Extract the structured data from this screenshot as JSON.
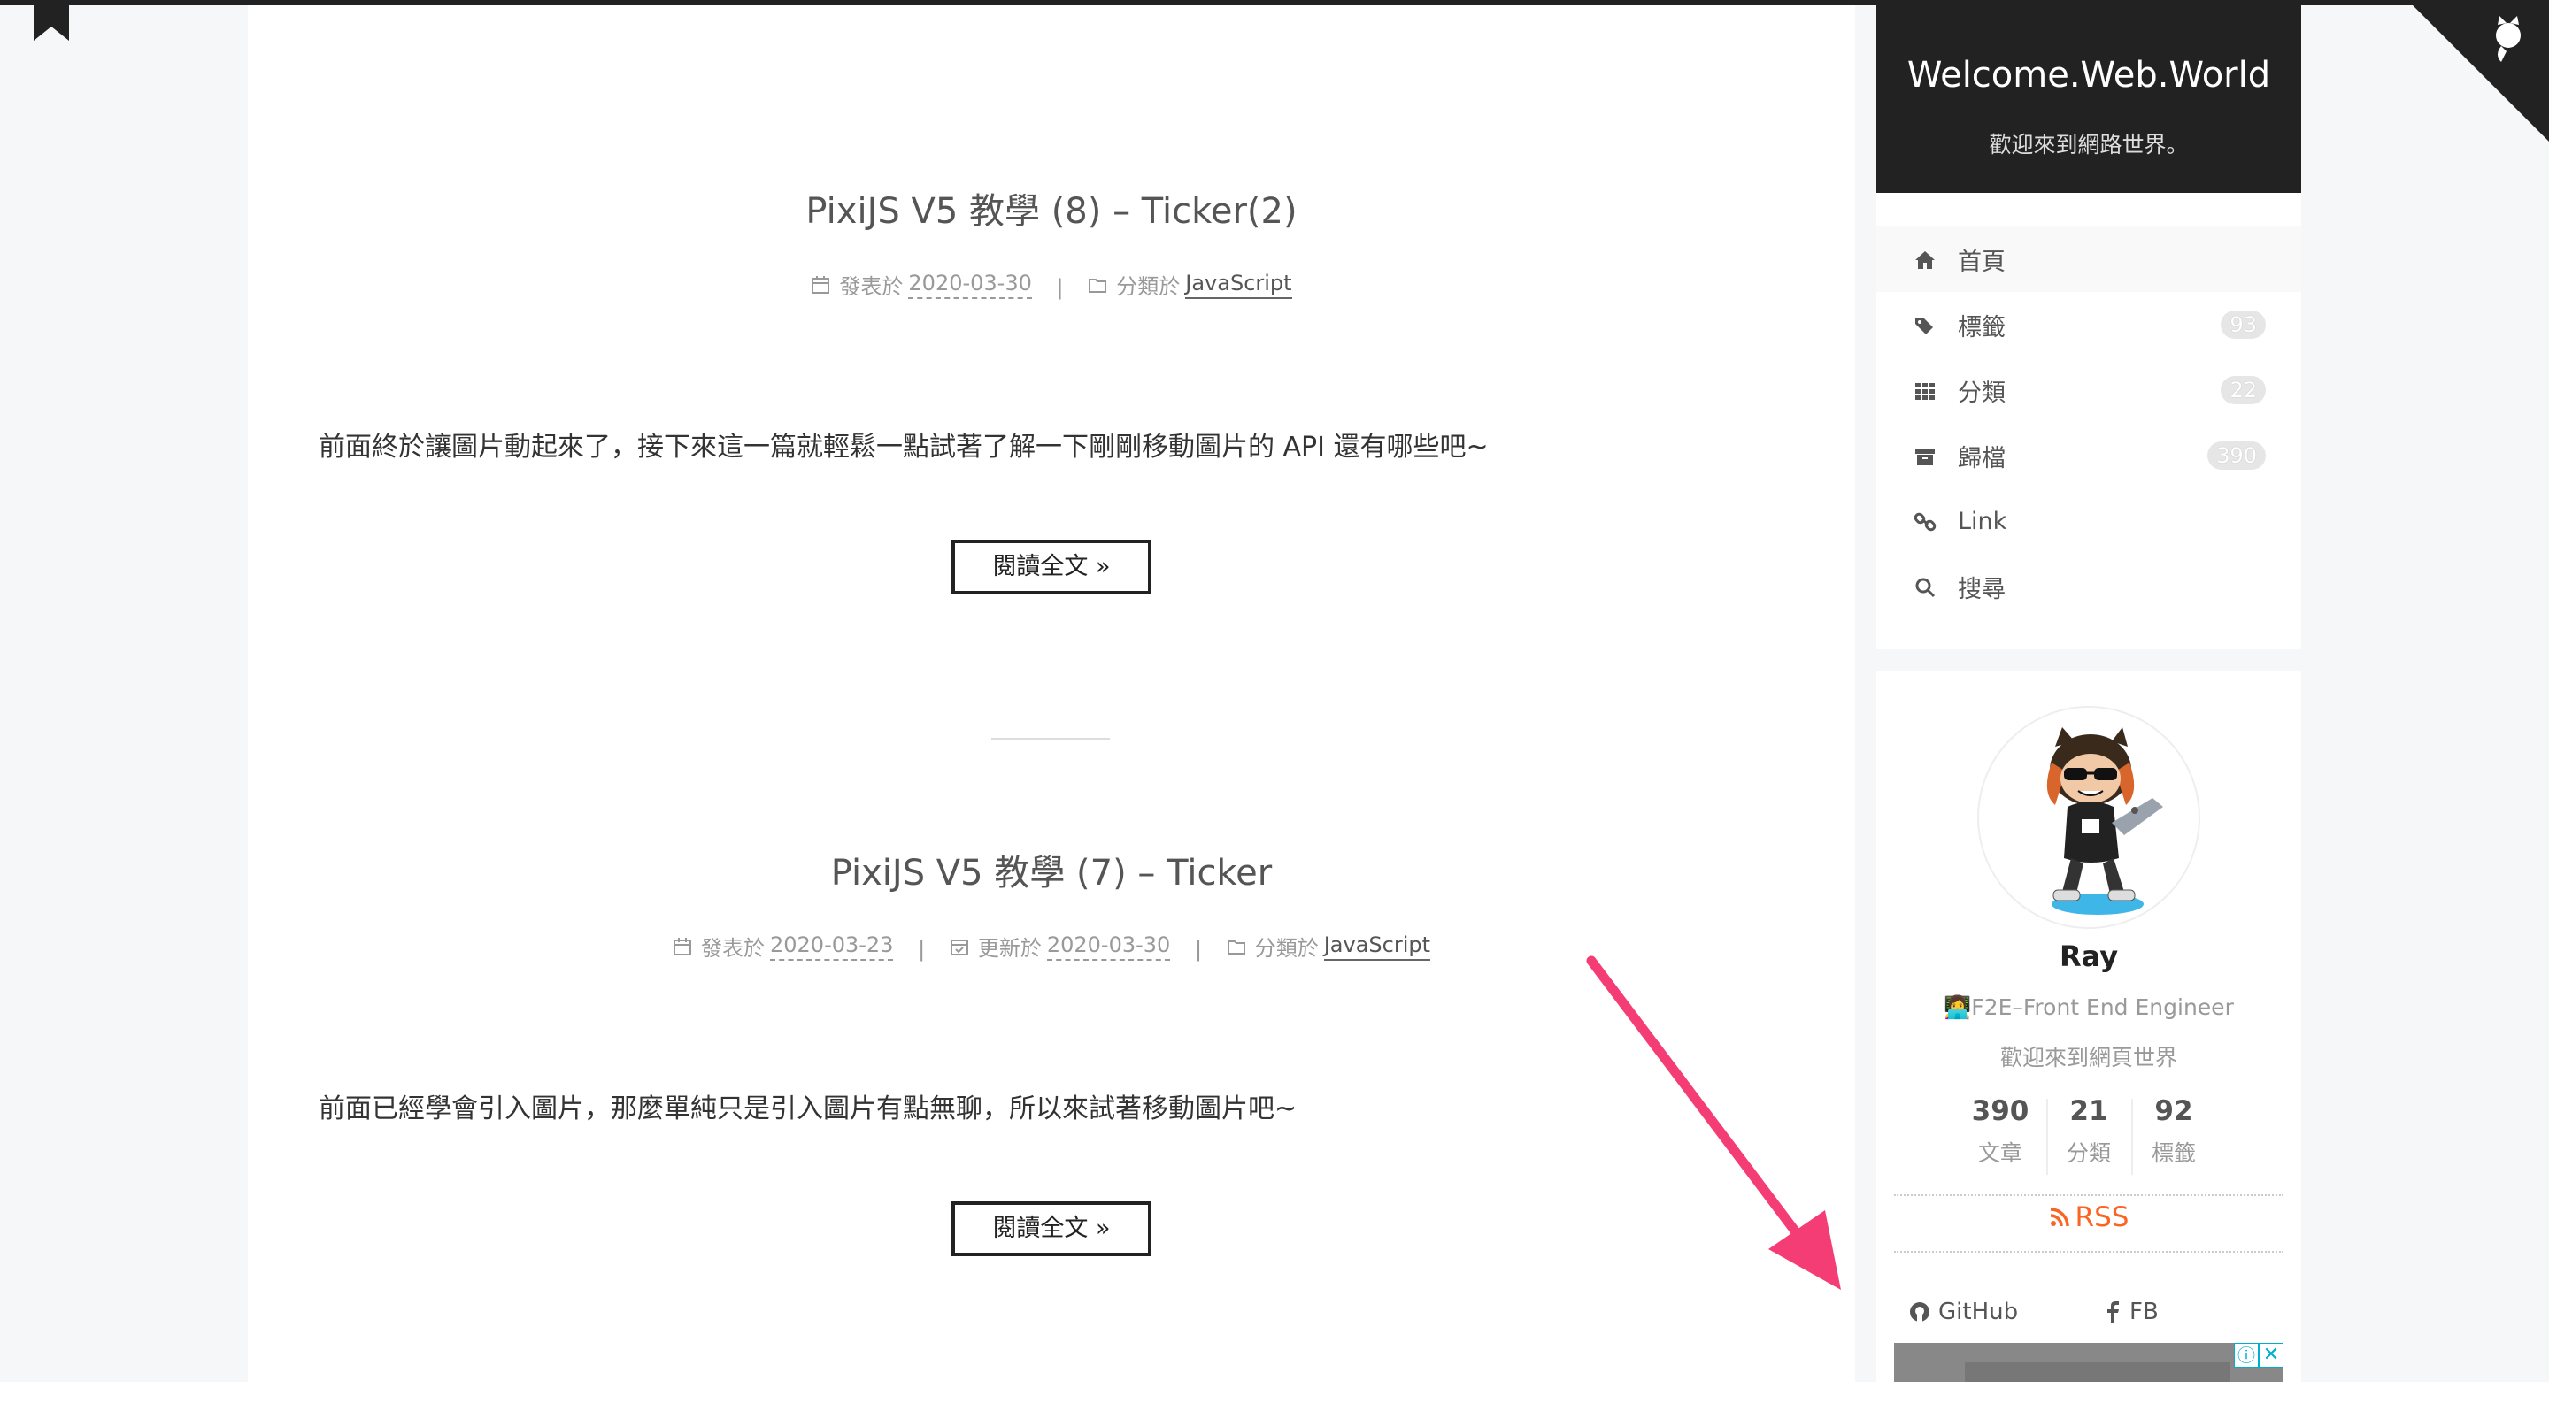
{
  "posts": [
    {
      "title": "PixiJS V5 教學 (8) – Ticker(2)",
      "published_label": "發表於",
      "published_date": "2020-03-30",
      "category_label": "分類於",
      "category": "JavaScript",
      "excerpt": "前面終於讓圖片動起來了，接下來這一篇就輕鬆一點試著了解一下剛剛移動圖片的 API 還有哪些吧~",
      "read_more": "閱讀全文 »"
    },
    {
      "title": "PixiJS V5 教學 (7) – Ticker",
      "published_label": "發表於",
      "published_date": "2020-03-23",
      "updated_label": "更新於",
      "updated_date": "2020-03-30",
      "category_label": "分類於",
      "category": "JavaScript",
      "excerpt": "前面已經學會引入圖片，那麼單純只是引入圖片有點無聊，所以來試著移動圖片吧~",
      "read_more": "閱讀全文 »"
    }
  ],
  "meta_separator": "|",
  "site": {
    "title": "Welcome.Web.World",
    "subtitle": "歡迎來到網路世界。"
  },
  "menu": [
    {
      "label": "首頁",
      "icon": "home-icon",
      "active": true
    },
    {
      "label": "標籤",
      "icon": "tags-icon",
      "badge": "93"
    },
    {
      "label": "分類",
      "icon": "th-icon",
      "badge": "22"
    },
    {
      "label": "歸檔",
      "icon": "archive-icon",
      "badge": "390"
    },
    {
      "label": "Link",
      "icon": "link-icon"
    },
    {
      "label": "搜尋",
      "icon": "search-icon"
    }
  ],
  "author": {
    "name": "Ray",
    "description": "👩‍💻F2E–Front End Engineer",
    "motto": "歡迎來到網頁世界"
  },
  "stats": [
    {
      "count": "390",
      "name": "文章"
    },
    {
      "count": "21",
      "name": "分類"
    },
    {
      "count": "92",
      "name": "標籤"
    }
  ],
  "rss_label": "RSS",
  "social": [
    {
      "label": "GitHub",
      "icon": "github-icon"
    },
    {
      "label": "FB",
      "icon": "facebook-icon"
    }
  ],
  "ad": {
    "info_glyph": "ⓘ",
    "close_glyph": "✕"
  },
  "colors": {
    "brand_bg": "#222222",
    "rss": "#fc6423",
    "annotation_arrow": "#f53d75",
    "page_bg": "#f5f7f9"
  }
}
